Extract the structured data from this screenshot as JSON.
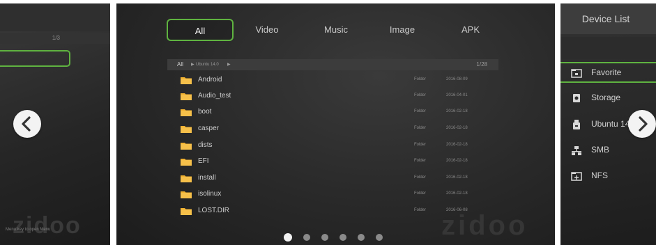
{
  "left_panel": {
    "page_count": "1/3",
    "hint": "Menu key to open Menu",
    "watermark": "zidoo"
  },
  "main": {
    "tabs": [
      {
        "label": "All",
        "active": true
      },
      {
        "label": "Video",
        "active": false
      },
      {
        "label": "Music",
        "active": false
      },
      {
        "label": "Image",
        "active": false
      },
      {
        "label": "APK",
        "active": false
      }
    ],
    "breadcrumb": {
      "root": "All",
      "current": "Ubuntu 14.0"
    },
    "page_count": "1/28",
    "files": [
      {
        "name": "Android",
        "type": "Folder",
        "date": "2016-08-09"
      },
      {
        "name": "Audio_test",
        "type": "Folder",
        "date": "2016-04-01"
      },
      {
        "name": "boot",
        "type": "Folder",
        "date": "2016-02-18"
      },
      {
        "name": "casper",
        "type": "Folder",
        "date": "2016-02-18"
      },
      {
        "name": "dists",
        "type": "Folder",
        "date": "2016-02-18"
      },
      {
        "name": "EFI",
        "type": "Folder",
        "date": "2016-02-18"
      },
      {
        "name": "install",
        "type": "Folder",
        "date": "2016-02-18"
      },
      {
        "name": "isolinux",
        "type": "Folder",
        "date": "2016-02-18"
      },
      {
        "name": "LOST.DIR",
        "type": "Folder",
        "date": "2016-06-08"
      }
    ],
    "watermark": "zidoo",
    "page_dots": 6,
    "active_dot": 0
  },
  "device_list": {
    "title": "Device List",
    "items": [
      {
        "label": "Favorite",
        "icon": "favorite-folder-icon",
        "active": true
      },
      {
        "label": "Storage",
        "icon": "storage-icon",
        "active": false
      },
      {
        "label": "Ubuntu 14.0",
        "icon": "usb-drive-icon",
        "active": false
      },
      {
        "label": "SMB",
        "icon": "network-icon",
        "active": false
      },
      {
        "label": "NFS",
        "icon": "nfs-icon",
        "active": false
      }
    ]
  },
  "colors": {
    "accent": "#5fb340",
    "folder": "#f2b230",
    "panel_bg": "#2a2a2a"
  }
}
